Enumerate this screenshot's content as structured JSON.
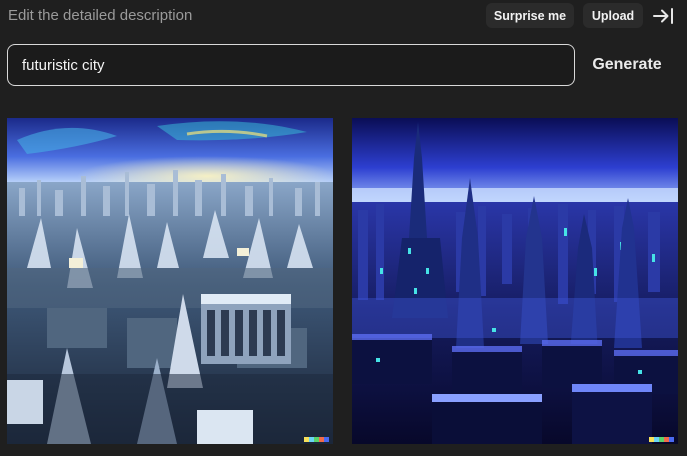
{
  "header": {
    "description_hint": "Edit the detailed description",
    "surprise_label": "Surprise me",
    "upload_label": "Upload",
    "collapse_icon": "collapse-right-icon"
  },
  "prompt": {
    "value": "futuristic city",
    "generate_label": "Generate"
  },
  "results": {
    "images": [
      {
        "subject": "futuristic city"
      },
      {
        "subject": "futuristic city"
      }
    ]
  },
  "colors": {
    "background": "#1f1f1f",
    "pill": "#2b2b2b",
    "input_border": "#d9d9d9",
    "hint_text": "#9a9a9a",
    "watermark": [
      "#f7e15a",
      "#6ad5f5",
      "#5bd36b",
      "#f26b4a",
      "#4a6af2"
    ]
  }
}
